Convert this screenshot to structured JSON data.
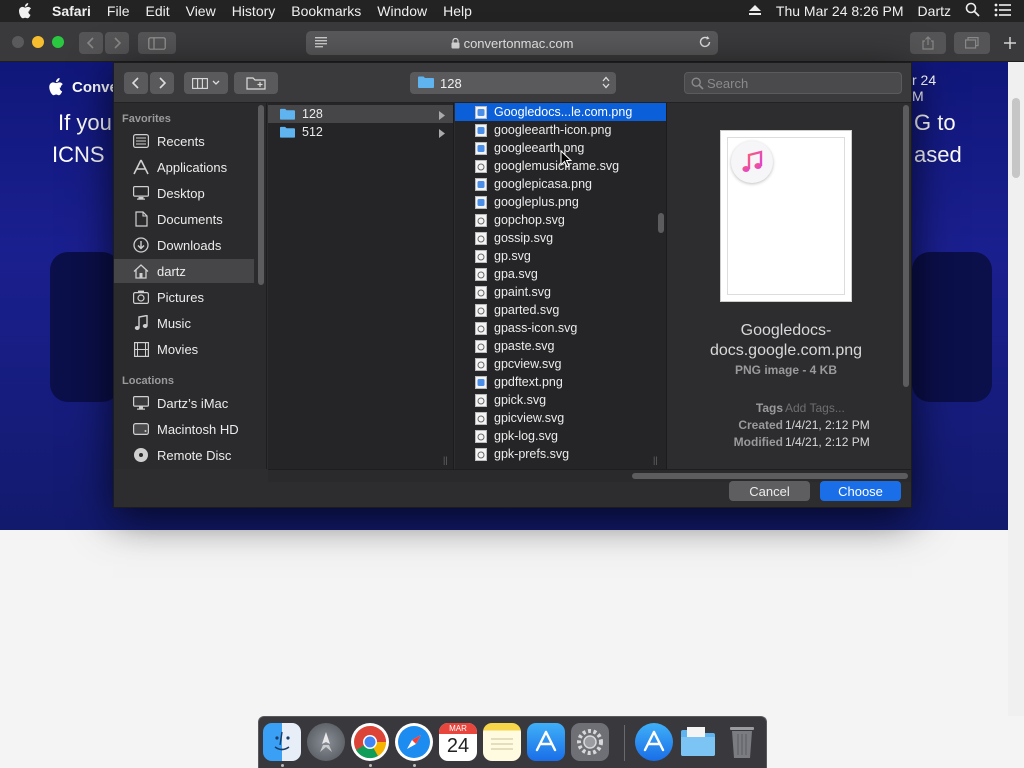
{
  "menubar": {
    "app": "Safari",
    "items": [
      "File",
      "Edit",
      "View",
      "History",
      "Bookmarks",
      "Window",
      "Help"
    ],
    "clock": "Thu Mar 24  8:26 PM",
    "user": "Dartz"
  },
  "safari": {
    "url": "convertonmac.com"
  },
  "webpage": {
    "brand": "Conve",
    "hero_left_1": "If you",
    "hero_left_2": "ICNS",
    "hero_right_1": "G to",
    "hero_right_2": "ased",
    "date_frag_1": "r 24",
    "date_frag_2": "M"
  },
  "dialog": {
    "path": "128",
    "search_placeholder": "Search",
    "sidebar": {
      "favorites_header": "Favorites",
      "favorites": [
        {
          "label": "Recents",
          "icon": "recents-icon"
        },
        {
          "label": "Applications",
          "icon": "applications-icon"
        },
        {
          "label": "Desktop",
          "icon": "desktop-icon"
        },
        {
          "label": "Documents",
          "icon": "documents-icon"
        },
        {
          "label": "Downloads",
          "icon": "downloads-icon"
        },
        {
          "label": "dartz",
          "icon": "home-icon"
        },
        {
          "label": "Pictures",
          "icon": "pictures-icon"
        },
        {
          "label": "Music",
          "icon": "music-icon"
        },
        {
          "label": "Movies",
          "icon": "movies-icon"
        }
      ],
      "locations_header": "Locations",
      "locations": [
        {
          "label": "Dartz’s iMac",
          "icon": "imac-icon"
        },
        {
          "label": "Macintosh HD",
          "icon": "harddisk-icon"
        },
        {
          "label": "Remote Disc",
          "icon": "disc-icon"
        }
      ]
    },
    "column1": [
      "128",
      "512"
    ],
    "column2": [
      {
        "name": "Googledocs...le.com.png",
        "kind": "png"
      },
      {
        "name": "googleearth-icon.png",
        "kind": "png"
      },
      {
        "name": "googleearth.png",
        "kind": "png"
      },
      {
        "name": "googlemusicframe.svg",
        "kind": "svg"
      },
      {
        "name": "googlepicasa.png",
        "kind": "png"
      },
      {
        "name": "googleplus.png",
        "kind": "png"
      },
      {
        "name": "gopchop.svg",
        "kind": "svg"
      },
      {
        "name": "gossip.svg",
        "kind": "svg"
      },
      {
        "name": "gp.svg",
        "kind": "svg"
      },
      {
        "name": "gpa.svg",
        "kind": "svg"
      },
      {
        "name": "gpaint.svg",
        "kind": "svg"
      },
      {
        "name": "gparted.svg",
        "kind": "svg"
      },
      {
        "name": "gpass-icon.svg",
        "kind": "svg"
      },
      {
        "name": "gpaste.svg",
        "kind": "svg"
      },
      {
        "name": "gpcview.svg",
        "kind": "svg"
      },
      {
        "name": "gpdftext.png",
        "kind": "png"
      },
      {
        "name": "gpick.svg",
        "kind": "svg"
      },
      {
        "name": "gpicview.svg",
        "kind": "svg"
      },
      {
        "name": "gpk-log.svg",
        "kind": "svg"
      },
      {
        "name": "gpk-prefs.svg",
        "kind": "svg"
      }
    ],
    "preview": {
      "name_line1": "Googledocs-",
      "name_line2": "docs.google.com.png",
      "kind": "PNG image - 4 KB",
      "tags_label": "Tags",
      "tags_value": "Add Tags...",
      "created_label": "Created",
      "created_value": "1/4/21, 2:12 PM",
      "modified_label": "Modified",
      "modified_value": "1/4/21, 2:12 PM"
    },
    "cancel_label": "Cancel",
    "choose_label": "Choose"
  },
  "dock": {
    "calendar_month": "MAR",
    "calendar_day": "24",
    "apps": [
      "finder-icon",
      "launchpad-icon",
      "chrome-icon",
      "safari-icon",
      "calendar-icon",
      "notes-icon",
      "app-store-icon",
      "system-preferences-icon",
      "app-store-download-icon",
      "folder-icon",
      "trash-icon"
    ]
  },
  "colors": {
    "selection_blue": "#0b5fd8",
    "choose_button": "#1a6ee8",
    "hero_blue": "#1a1f8f"
  }
}
